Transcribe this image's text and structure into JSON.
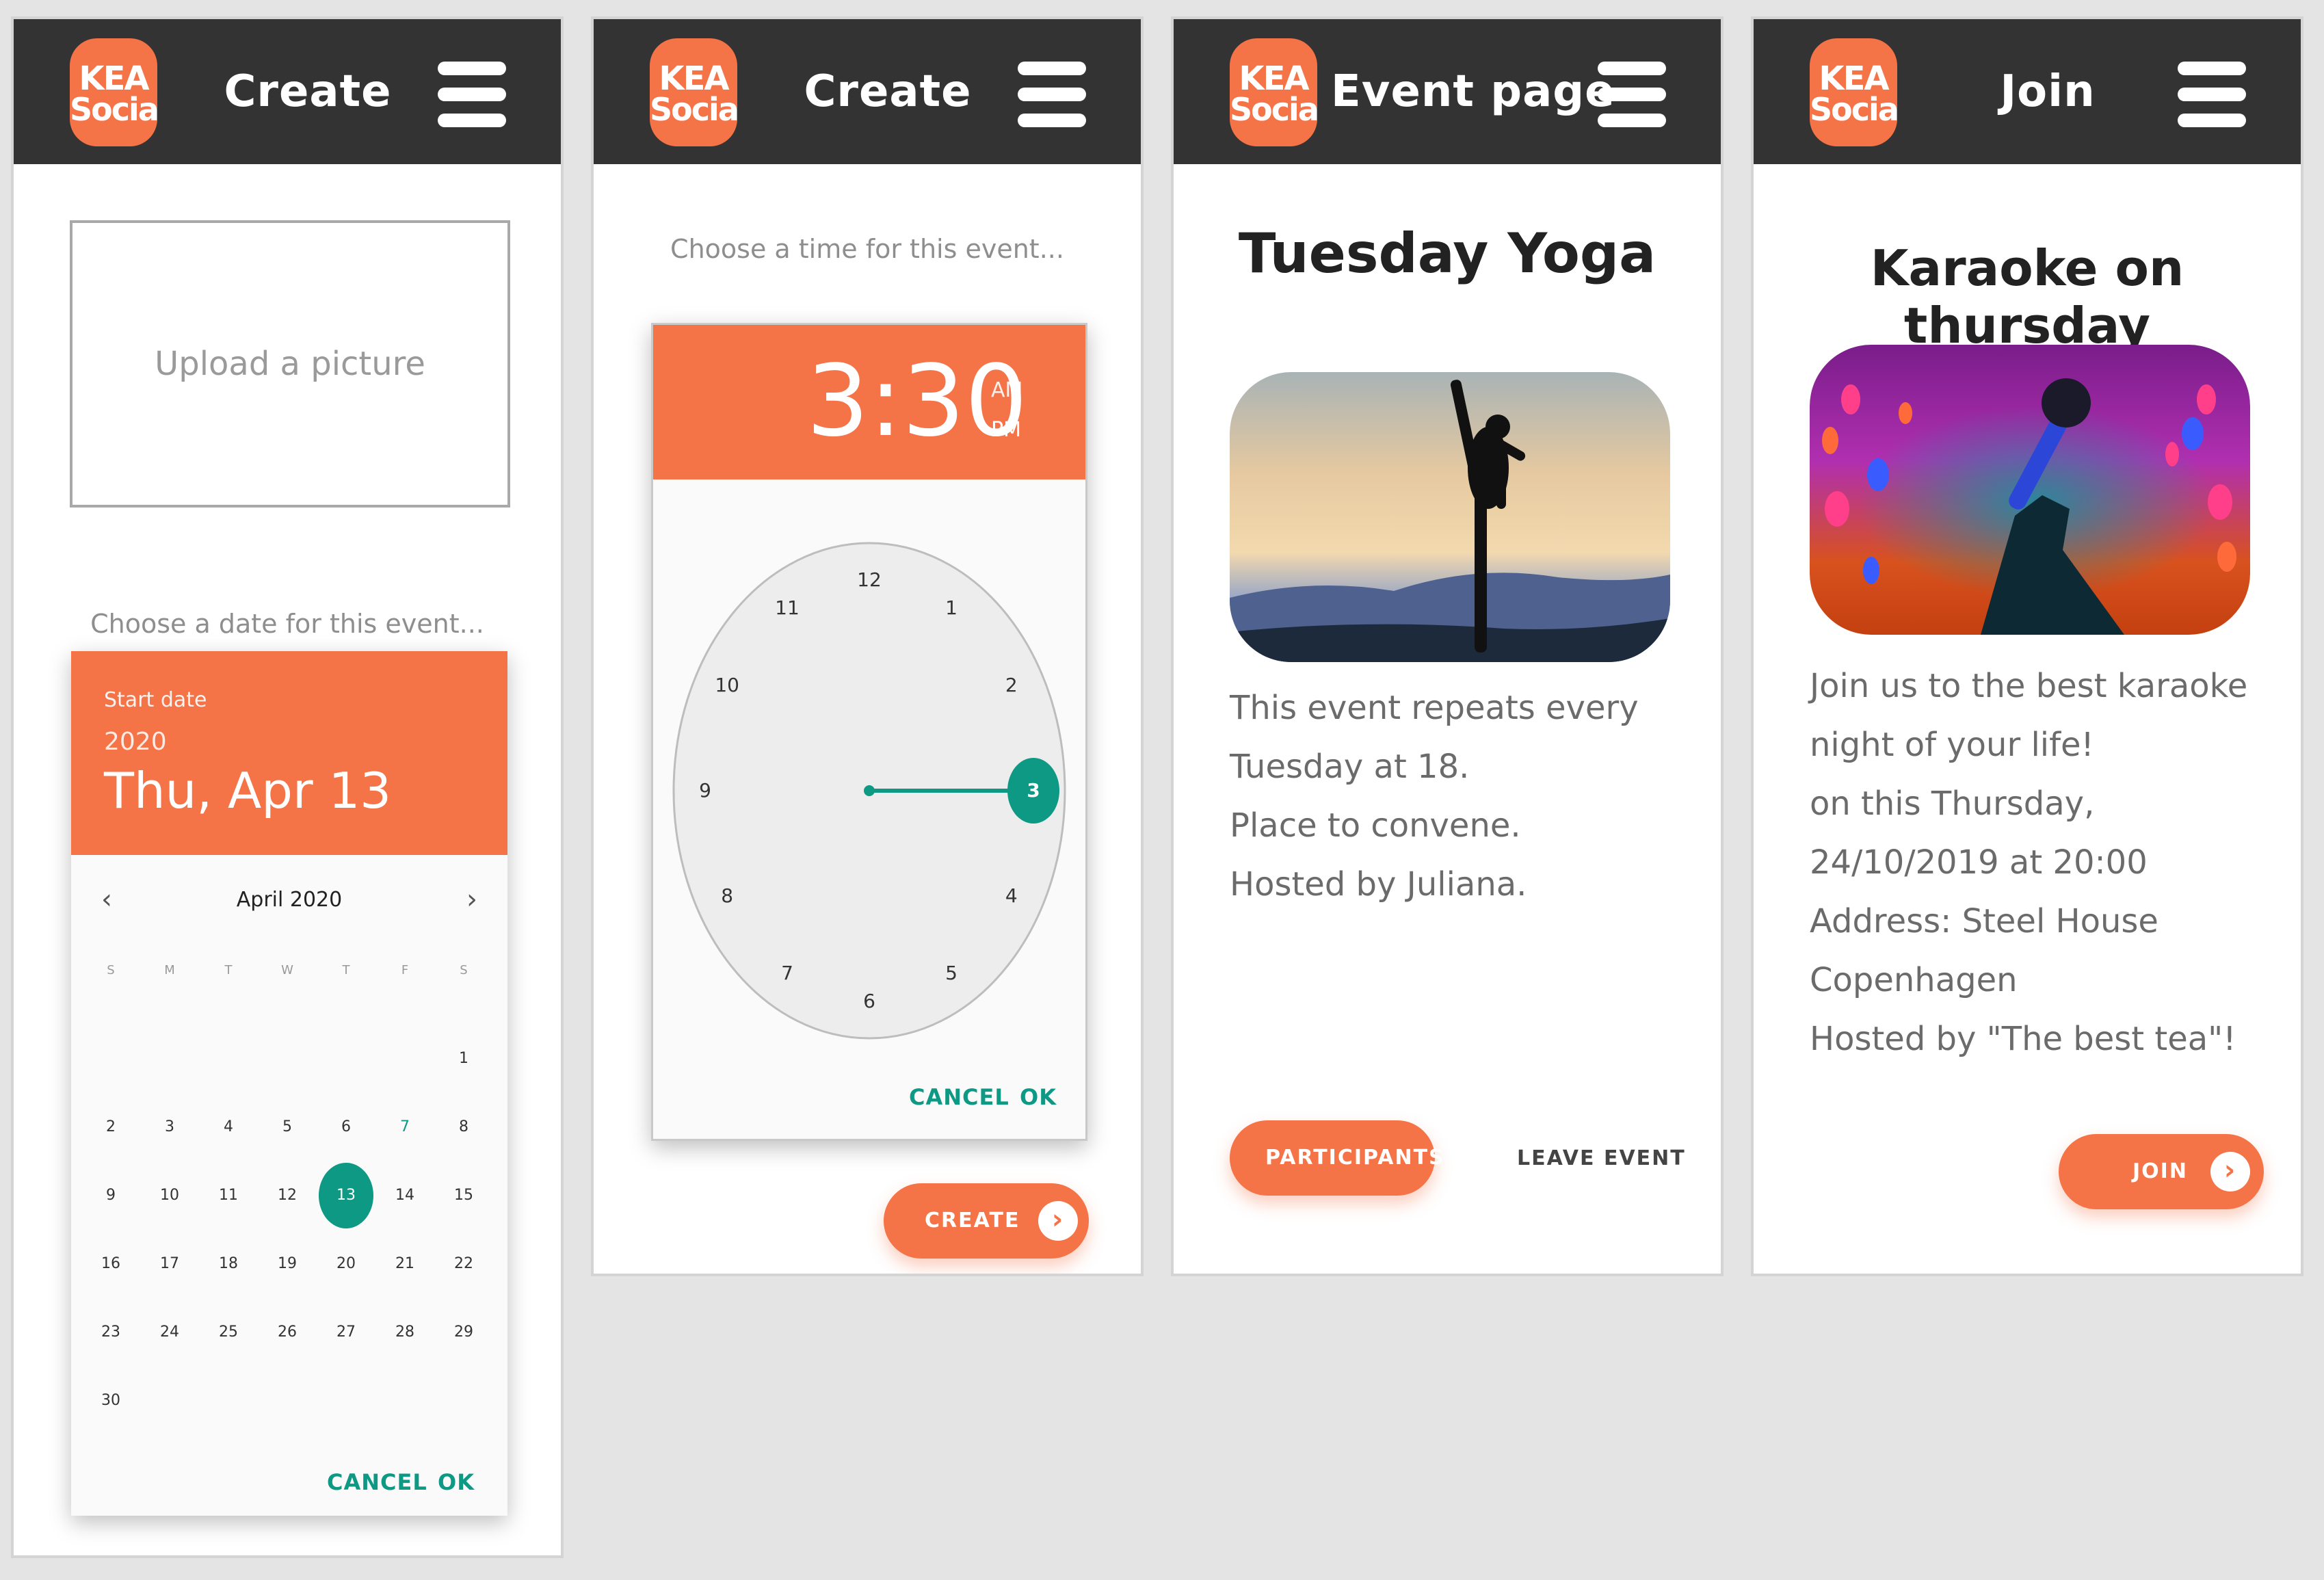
{
  "brand": {
    "line1": "KEA",
    "line2": "Social",
    "accent": "#f47347",
    "teal": "#0e9984",
    "header_bg": "#333333"
  },
  "screen1": {
    "title": "Create",
    "upload_label": "Upload a picture",
    "date_prompt": "Choose a date for this event...",
    "datepicker": {
      "start_label": "Start date",
      "year": "2020",
      "date": "Thu, Apr 13",
      "month": "April 2020",
      "weekdays": [
        "S",
        "M",
        "T",
        "W",
        "T",
        "F",
        "S"
      ],
      "weeks": [
        [
          "",
          "",
          "",
          "",
          "",
          "",
          "1"
        ],
        [
          "2",
          "3",
          "4",
          "5",
          "6",
          "7",
          "8"
        ],
        [
          "9",
          "10",
          "11",
          "12",
          "13",
          "14",
          "15"
        ],
        [
          "16",
          "17",
          "18",
          "19",
          "20",
          "21",
          "22"
        ],
        [
          "23",
          "24",
          "25",
          "26",
          "27",
          "28",
          "29"
        ],
        [
          "30",
          "",
          "",
          "",
          "",
          "",
          ""
        ]
      ],
      "selected": "13",
      "today": "7",
      "cancel": "CANCEL",
      "ok": "OK"
    }
  },
  "screen2": {
    "title": "Create",
    "time_prompt": "Choose a time for this event...",
    "timepicker": {
      "time": "3:30",
      "am": "AM",
      "pm": "PM",
      "selected_hour": 3,
      "numbers": [
        "12",
        "1",
        "2",
        "3",
        "4",
        "5",
        "6",
        "7",
        "8",
        "9",
        "10",
        "11"
      ],
      "cancel": "CANCEL",
      "ok": "OK"
    },
    "create_label": "CREATE"
  },
  "screen3": {
    "title": "Event page",
    "event_title": "Tuesday Yoga",
    "image_icon": "yoga-photo",
    "description": [
      "This event repeats every",
      "Tuesday at 18.",
      "Place to convene.",
      "Hosted by Juliana."
    ],
    "participants_label": "PARTICIPANTS",
    "leave_label": "LEAVE EVENT"
  },
  "screen4": {
    "title": "Join",
    "event_title": "Karaoke on thursday",
    "image_icon": "karaoke-photo",
    "description": [
      "Join us to the best karaoke",
      "night of your life!",
      "on this Thursday,",
      "24/10/2019 at 20:00",
      "Address:  Steel House",
      "Copenhagen",
      "Hosted by \"The best tea\"!"
    ],
    "join_label": "JOIN"
  }
}
